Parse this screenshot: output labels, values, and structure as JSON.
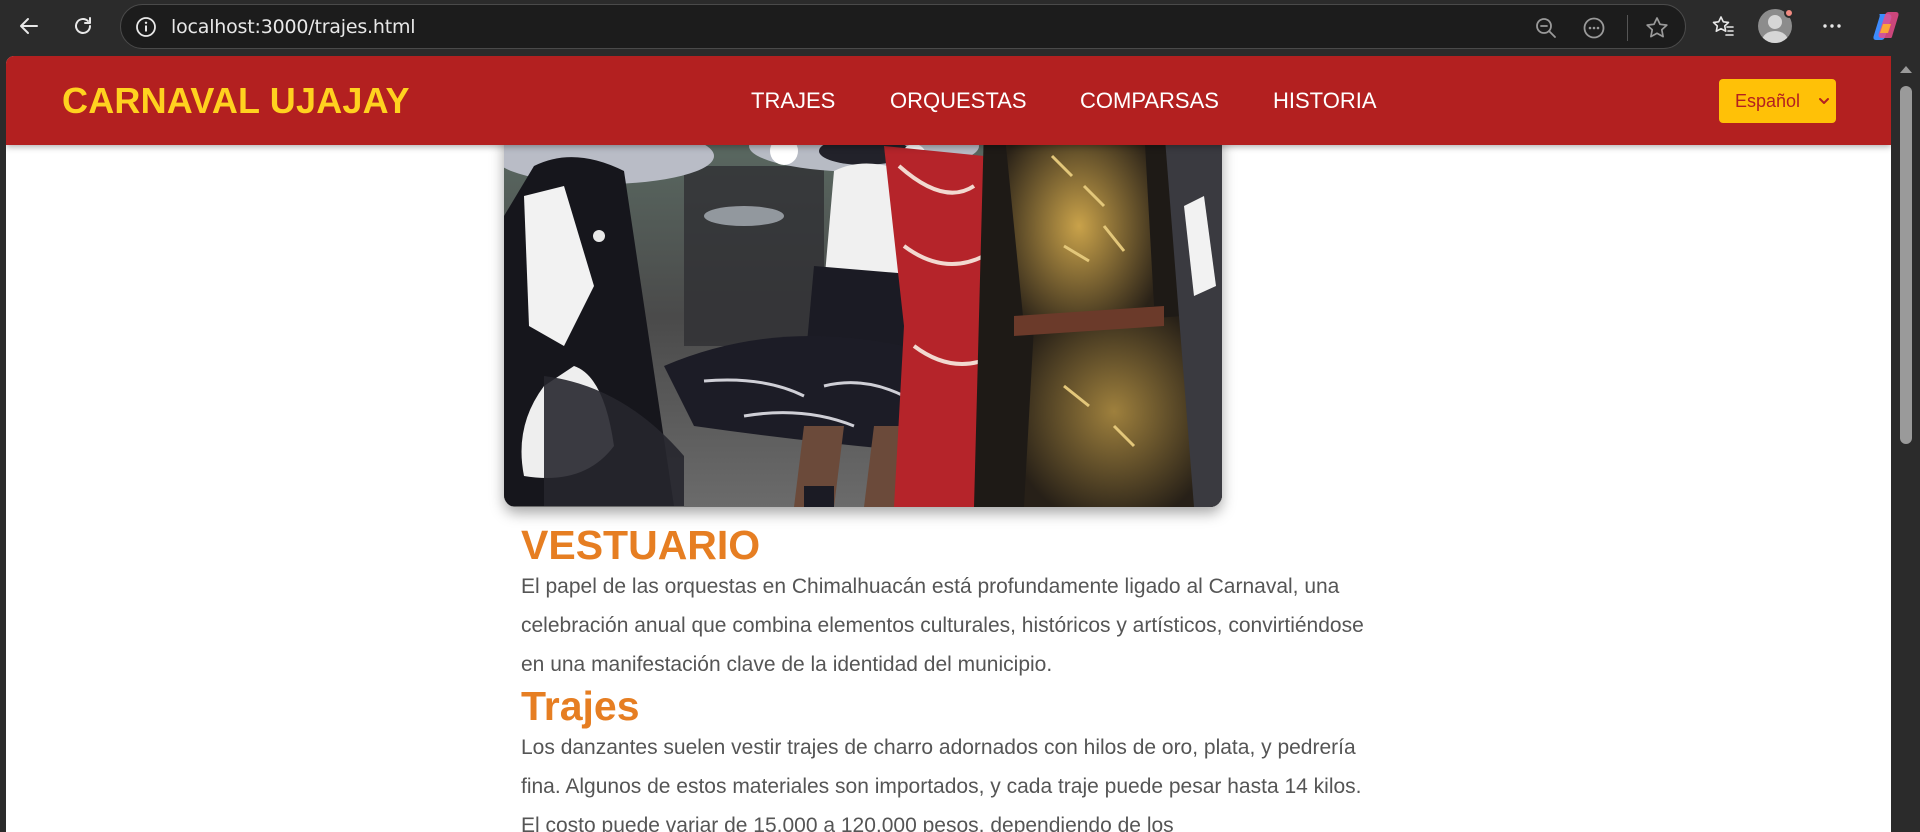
{
  "browser": {
    "url": "localhost:3000/trajes.html"
  },
  "site": {
    "logo": "CARNAVAL UJAJAY",
    "nav": [
      "TRAJES",
      "ORQUESTAS",
      "COMPARSAS",
      "HISTORIA"
    ],
    "language": "Español"
  },
  "content": {
    "section1_title": "VESTUARIO",
    "section1_text": "El papel de las orquestas en Chimalhuacán está profundamente ligado al Carnaval, una celebración anual que combina elementos culturales, históricos y artísticos, convirtiéndose en una manifestación clave de la identidad del municipio.",
    "section2_title": "Trajes",
    "section2_text": "Los danzantes suelen vestir trajes de charro adornados con hilos de oro, plata, y pedrería fina. Algunos de estos materiales son importados, y cada traje puede pesar hasta 14 kilos. El costo puede variar de 15,000 a 120,000 pesos, dependiendo de los"
  },
  "colors": {
    "header_bg": "#b32020",
    "logo": "#ffd21f",
    "heading": "#e67e22",
    "lang_button": "#ffc107"
  },
  "icons": [
    "back-icon",
    "reload-icon",
    "info-icon",
    "zoom-out-icon",
    "reading-mode-icon",
    "favorite-star-icon",
    "favorites-list-icon",
    "profile-avatar-icon",
    "more-menu-icon",
    "copilot-icon"
  ]
}
